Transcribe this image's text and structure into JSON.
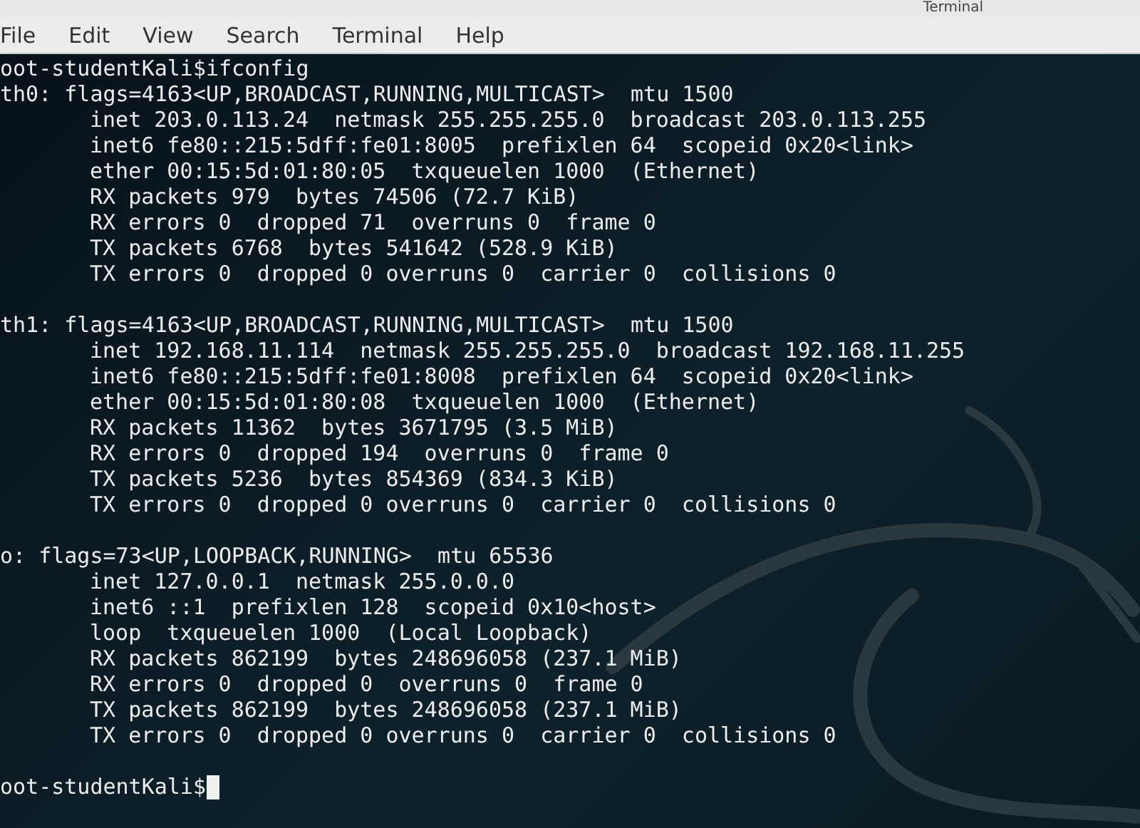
{
  "window": {
    "title": "Terminal"
  },
  "menu": [
    "File",
    "Edit",
    "View",
    "Search",
    "Terminal",
    "Help"
  ],
  "command": {
    "prompt": "oot-studentKali$",
    "text": "ifconfig"
  },
  "interfaces": [
    {
      "header": "th0: flags=4163<UP,BROADCAST,RUNNING,MULTICAST>  mtu 1500",
      "lines": [
        "inet 203.0.113.24  netmask 255.255.255.0  broadcast 203.0.113.255",
        "inet6 fe80::215:5dff:fe01:8005  prefixlen 64  scopeid 0x20<link>",
        "ether 00:15:5d:01:80:05  txqueuelen 1000  (Ethernet)",
        "RX packets 979  bytes 74506 (72.7 KiB)",
        "RX errors 0  dropped 71  overruns 0  frame 0",
        "TX packets 6768  bytes 541642 (528.9 KiB)",
        "TX errors 0  dropped 0 overruns 0  carrier 0  collisions 0"
      ]
    },
    {
      "header": "th1: flags=4163<UP,BROADCAST,RUNNING,MULTICAST>  mtu 1500",
      "lines": [
        "inet 192.168.11.114  netmask 255.255.255.0  broadcast 192.168.11.255",
        "inet6 fe80::215:5dff:fe01:8008  prefixlen 64  scopeid 0x20<link>",
        "ether 00:15:5d:01:80:08  txqueuelen 1000  (Ethernet)",
        "RX packets 11362  bytes 3671795 (3.5 MiB)",
        "RX errors 0  dropped 194  overruns 0  frame 0",
        "TX packets 5236  bytes 854369 (834.3 KiB)",
        "TX errors 0  dropped 0 overruns 0  carrier 0  collisions 0"
      ]
    },
    {
      "header": "o: flags=73<UP,LOOPBACK,RUNNING>  mtu 65536",
      "lines": [
        "inet 127.0.0.1  netmask 255.0.0.0",
        "inet6 ::1  prefixlen 128  scopeid 0x10<host>",
        "loop  txqueuelen 1000  (Local Loopback)",
        "RX packets 862199  bytes 248696058 (237.1 MiB)",
        "RX errors 0  dropped 0  overruns 0  frame 0",
        "TX packets 862199  bytes 248696058 (237.1 MiB)",
        "TX errors 0  dropped 0 overruns 0  carrier 0  collisions 0"
      ]
    }
  ],
  "prompt": "oot-studentKali$"
}
